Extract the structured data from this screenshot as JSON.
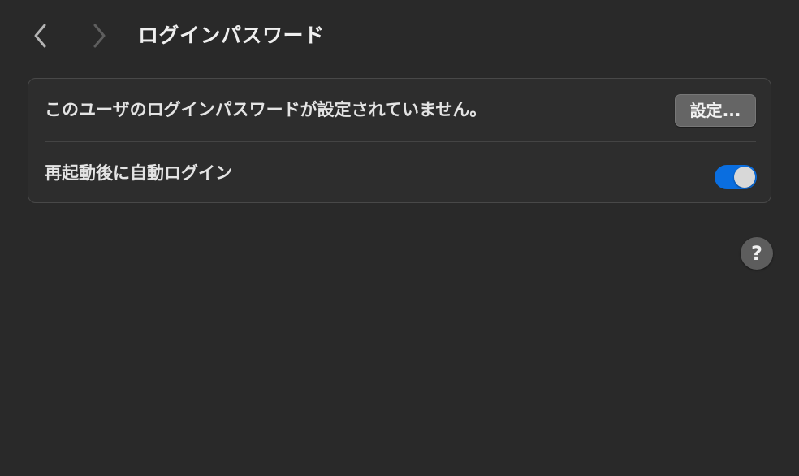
{
  "header": {
    "title": "ログインパスワード",
    "back_icon": "chevron-left-icon",
    "forward_icon": "chevron-right-icon"
  },
  "settings": {
    "password_row": {
      "label": "このユーザのログインパスワードが設定されていません。",
      "button_label": "設定..."
    },
    "auto_login_row": {
      "label": "再起動後に自動ログイン",
      "toggle_on": true
    }
  },
  "help": {
    "label": "?",
    "icon": "help-icon"
  },
  "colors": {
    "background": "#292929",
    "panel": "#2d2d2d",
    "accent": "#0a6ee0",
    "button": "#656565"
  }
}
